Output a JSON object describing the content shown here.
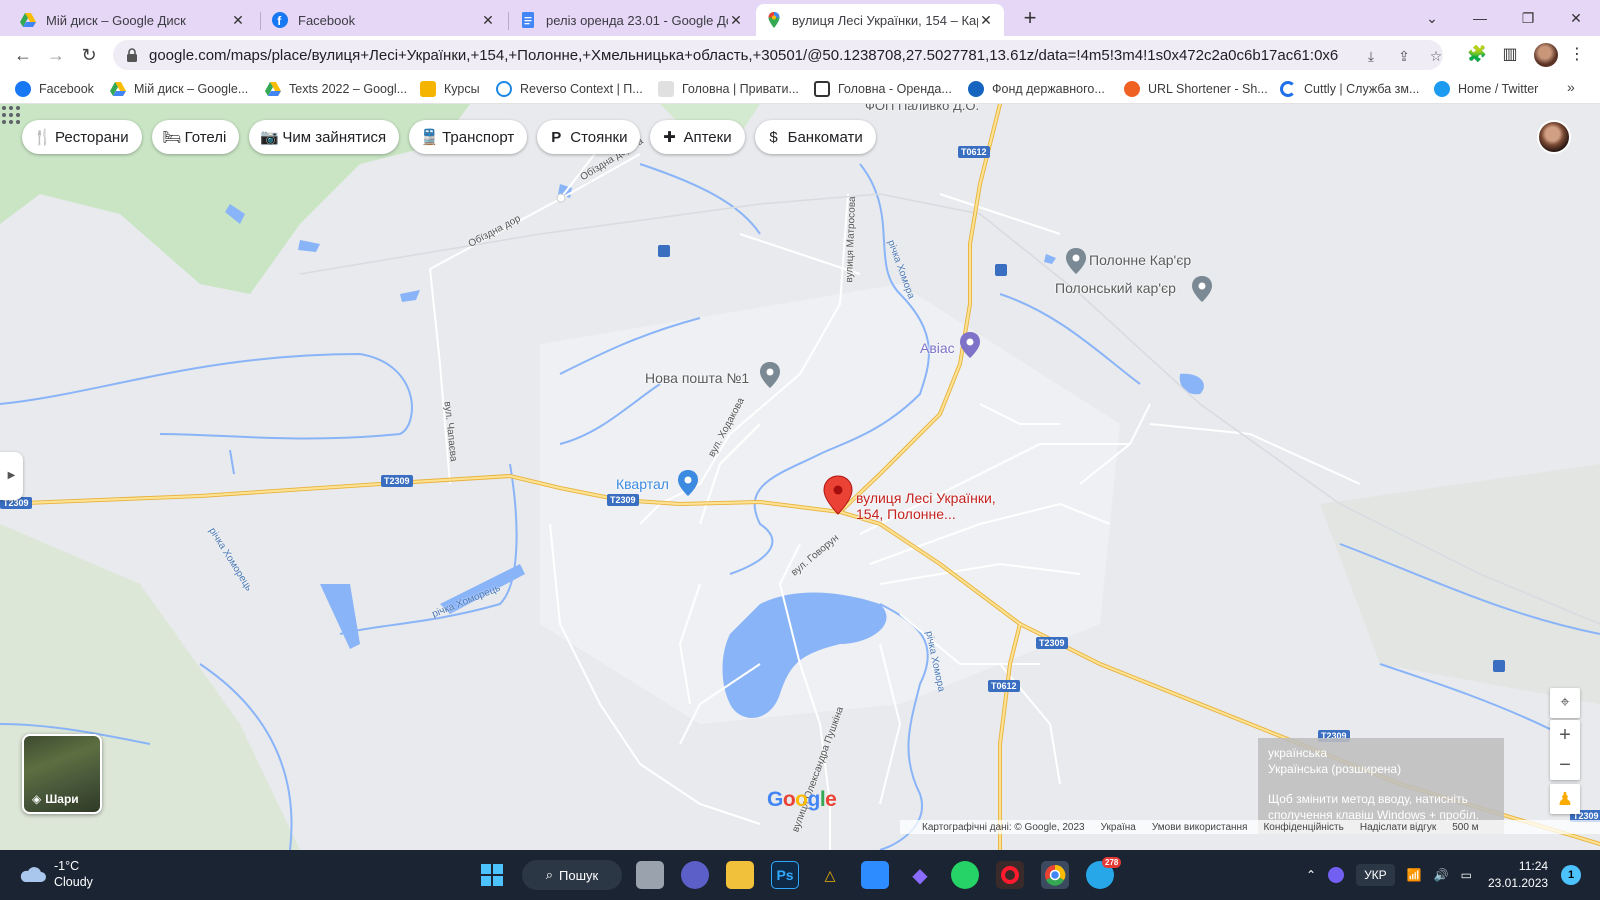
{
  "browser": {
    "tabs": [
      {
        "title": "Мій диск – Google Диск",
        "icon": "google-drive-icon",
        "active": false
      },
      {
        "title": "Facebook",
        "icon": "facebook-icon",
        "active": false
      },
      {
        "title": "реліз оренда 23.01 - Google Док",
        "icon": "google-docs-icon",
        "active": false
      },
      {
        "title": "вулиця Лесі Українки, 154 – Кар",
        "icon": "google-maps-icon",
        "active": true
      }
    ],
    "url": "google.com/maps/place/вулиця+Лесі+Українки,+154,+Полонне,+Хмельницька+область,+30501/@50.1238708,27.5027781,13.61z/data=!4m5!3m4!1s0x472c2a0c6b17ac61:0x6df07f6..."
  },
  "bookmarks": [
    {
      "label": "Facebook",
      "icon": "facebook-icon",
      "color": "#1877f2"
    },
    {
      "label": "Мій диск – Google...",
      "icon": "google-drive-icon",
      "color": "#fbbc04"
    },
    {
      "label": "Texts 2022 – Googl...",
      "icon": "google-drive-icon",
      "color": "#34a853"
    },
    {
      "label": "Курсы",
      "icon": "emoji-icon",
      "color": "#f4b400"
    },
    {
      "label": "Reverso Context | П...",
      "icon": "reverso-icon",
      "color": "#1e88e5"
    },
    {
      "label": "Головна | Привати...",
      "icon": "building-icon",
      "color": "#777777"
    },
    {
      "label": "Головна - Оренда...",
      "icon": "emblem-icon",
      "color": "#333333"
    },
    {
      "label": "Фонд державного...",
      "icon": "fund-icon",
      "color": "#1565c0"
    },
    {
      "label": "URL Shortener - Sh...",
      "icon": "bitly-icon",
      "color": "#ee6123"
    },
    {
      "label": "Cuttly | Служба зм...",
      "icon": "cuttly-icon",
      "color": "#1f6feb"
    },
    {
      "label": "Home / Twitter",
      "icon": "twitter-icon",
      "color": "#1d9bf0"
    }
  ],
  "map": {
    "categories": [
      {
        "label": "Ресторани",
        "icon": "restaurant-icon",
        "glyph": "🍴"
      },
      {
        "label": "Готелі",
        "icon": "hotel-icon",
        "glyph": "🛏"
      },
      {
        "label": "Чим зайнятися",
        "icon": "camera-icon",
        "glyph": "📷"
      },
      {
        "label": "Транспорт",
        "icon": "transit-icon",
        "glyph": "🚆"
      },
      {
        "label": "Стоянки",
        "icon": "parking-icon",
        "glyph": "P"
      },
      {
        "label": "Аптеки",
        "icon": "pharmacy-icon",
        "glyph": "✚"
      },
      {
        "label": "Банкомати",
        "icon": "atm-icon",
        "glyph": "$"
      }
    ],
    "place_label_line1": "вулиця Лесі Українки,",
    "place_label_line2": "154, Полонне...",
    "poi": {
      "polonne_quarry": "Полонне Кар'єр",
      "polonsky_quarry": "Полонський кар'єр",
      "avias": "Авіас",
      "nova_poshta": "Нова пошта №1",
      "kvartal": "Квартал",
      "fop": "ФОП Паливко Д.О."
    },
    "streets": {
      "obizdna_1": "Обїздна дорога",
      "obizdna_2": "Обїздна дор",
      "matrosova": "вулиця Матросова",
      "chapaeva": "вул. Чапаєва",
      "khodakova": "вул. Ходакова",
      "govorun": "вул. Говорун",
      "pushkina": "вулиця Олександра Пушкіна"
    },
    "rivers": {
      "khomora_1": "річка Хомора",
      "khomora_2": "річка Хомора",
      "khomorets_1": "річка Хоморець",
      "khomorets_2": "річка Хоморець"
    },
    "road_shields": [
      "T2309",
      "T0612"
    ],
    "layers_label": "Шари",
    "google_logo_letters": [
      "G",
      "o",
      "o",
      "g",
      "l",
      "e"
    ],
    "google_logo_colors": [
      "#4285f4",
      "#ea4335",
      "#fbbc05",
      "#4285f4",
      "#34a853",
      "#ea4335"
    ],
    "attribution": {
      "data": "Картографічні дані: © Google, 2023",
      "country": "Україна",
      "terms": "Умови використання",
      "privacy": "Конфіденційність",
      "feedback": "Надіслати відгук",
      "scale": "500 м"
    },
    "ime_popup": {
      "lang": "українська",
      "layout": "Українська (розширена)",
      "hint": "Щоб змінити метод вводу, натисніть сполучення клавіш Windows + пробіл."
    }
  },
  "taskbar": {
    "weather_temp": "-1°C",
    "weather_desc": "Cloudy",
    "search_label": "Пошук",
    "telegram_badge": "278",
    "lang": "УКР",
    "time": "11:24",
    "date": "23.01.2023",
    "notification_count": "1"
  },
  "colors": {
    "tabstrip": "#e5d7f5",
    "road_major": "#f5c04a",
    "water": "#8ab4f8",
    "park": "#c9e5c4",
    "pin": "#ea4335",
    "taskbar": "#1a2433"
  }
}
